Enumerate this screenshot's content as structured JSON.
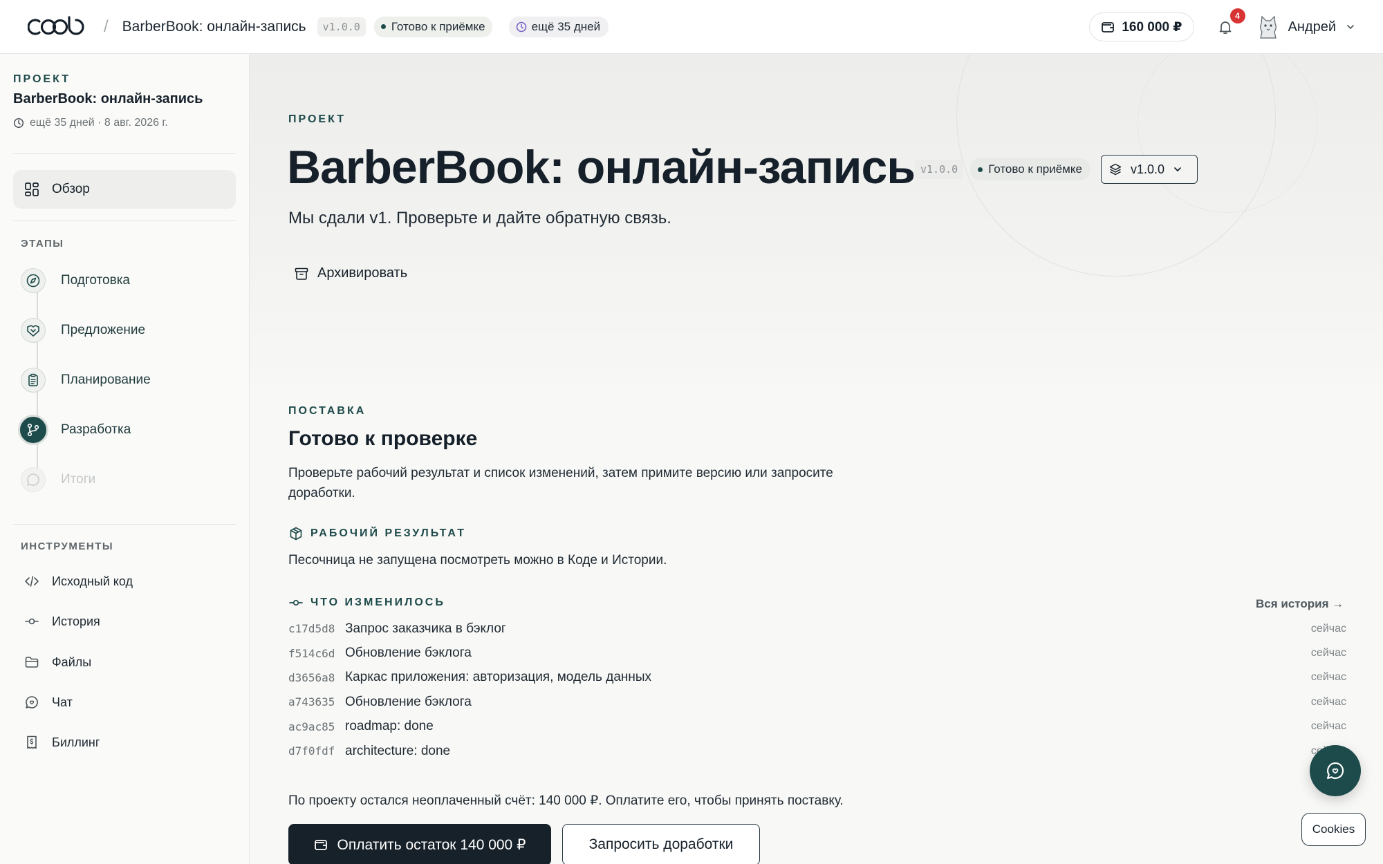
{
  "header": {
    "logo_text": "coob",
    "breadcrumb_sep": "/",
    "project_title": "BarberBook: онлайн-запись",
    "version": "v1.0.0",
    "status": "Готово к приёмке",
    "days_left": "ещё 35 дней",
    "balance": "160 000 ₽",
    "notifications_count": "4",
    "user_name": "Андрей"
  },
  "sidebar": {
    "project_label": "ПРОЕКТ",
    "project_title": "BarberBook: онлайн-запись",
    "project_meta": "ещё 35 дней · 8 авг. 2026 г.",
    "overview": "Обзор",
    "stages_label": "ЭТАПЫ",
    "stages": [
      {
        "label": "Подготовка",
        "icon": "compass-icon",
        "state": "done"
      },
      {
        "label": "Предложение",
        "icon": "handshake-icon",
        "state": "done"
      },
      {
        "label": "Планирование",
        "icon": "clipboard-icon",
        "state": "done"
      },
      {
        "label": "Разработка",
        "icon": "git-branch-icon",
        "state": "active"
      },
      {
        "label": "Итоги",
        "icon": "chat-icon",
        "state": "upcoming"
      }
    ],
    "tools_label": "ИНСТРУМЕНТЫ",
    "tools": [
      {
        "label": "Исходный код",
        "icon": "code-icon"
      },
      {
        "label": "История",
        "icon": "commit-icon"
      },
      {
        "label": "Файлы",
        "icon": "folder-icon"
      },
      {
        "label": "Чат",
        "icon": "chat-icon"
      },
      {
        "label": "Биллинг",
        "icon": "receipt-icon"
      }
    ]
  },
  "hero": {
    "eyebrow": "ПРОЕКТ",
    "title": "BarberBook: онлайн-запись",
    "version": "v1.0.0",
    "status": "Готово к приёмке",
    "version_select": "v1.0.0",
    "subtitle": "Мы сдали v1. Проверьте и дайте обратную связь.",
    "archive": "Архивировать"
  },
  "delivery": {
    "eyebrow": "ПОСТАВКА",
    "title": "Готово к проверке",
    "description": "Проверьте рабочий результат и список изменений, затем примите версию или запросите доработки.",
    "result_label": "РАБОЧИЙ РЕЗУЛЬТАТ",
    "result_text": "Песочница не запущена посмотреть можно в Коде и Истории.",
    "changes_label": "ЧТО ИЗМЕНИЛОСЬ",
    "all_history": "Вся история →",
    "commits": [
      {
        "hash": "c17d5d8",
        "message": "Запрос заказчика в бэклог",
        "time": "сейчас"
      },
      {
        "hash": "f514c6d",
        "message": "Обновление бэклога",
        "time": "сейчас"
      },
      {
        "hash": "d3656a8",
        "message": "Каркас приложения: авторизация, модель данных",
        "time": "сейчас"
      },
      {
        "hash": "a743635",
        "message": "Обновление бэклога",
        "time": "сейчас"
      },
      {
        "hash": "ac9ac85",
        "message": "roadmap: done",
        "time": "сейчас"
      },
      {
        "hash": "d7f0fdf",
        "message": "architecture: done",
        "time": "сейчас"
      }
    ],
    "unpaid_text": "По проекту остался неоплаченный счёт: 140 000 ₽. Оплатите его, чтобы принять поставку.",
    "pay_button": "Оплатить остаток 140 000 ₽",
    "request_button": "Запросить доработки"
  },
  "widgets": {
    "cookies": "Cookies"
  },
  "colors": {
    "accent": "#1d4a4a",
    "dark": "#172129",
    "badge": "#d93434"
  }
}
